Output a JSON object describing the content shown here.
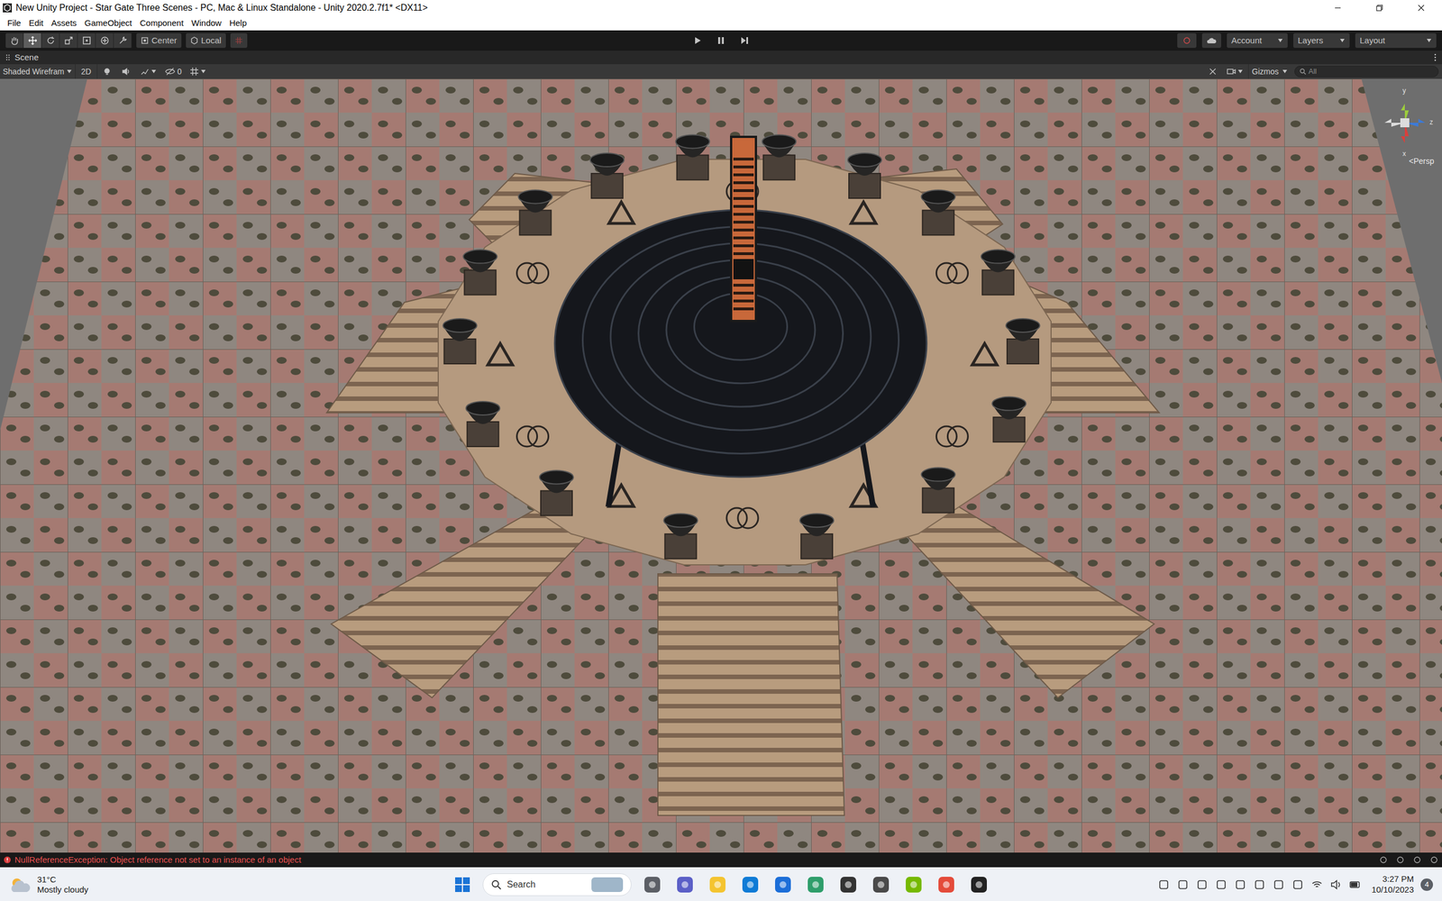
{
  "window": {
    "title": "New Unity Project - Star Gate Three Scenes - PC, Mac & Linux Standalone - Unity 2020.2.7f1* <DX11>"
  },
  "menu": [
    "File",
    "Edit",
    "Assets",
    "GameObject",
    "Component",
    "Window",
    "Help"
  ],
  "toolbar": {
    "tools": [
      {
        "kind": "hand",
        "selected": false
      },
      {
        "kind": "move",
        "selected": true
      },
      {
        "kind": "rotate",
        "selected": false
      },
      {
        "kind": "scale",
        "selected": false
      },
      {
        "kind": "rect",
        "selected": false
      },
      {
        "kind": "transform",
        "selected": false
      },
      {
        "kind": "custom",
        "selected": false
      }
    ],
    "pivot": "Center",
    "space": "Local",
    "account": "Account",
    "layers": "Layers",
    "layout": "Layout"
  },
  "scene": {
    "tab": "Scene",
    "shading": "Shaded Wirefram",
    "mode_2d": "2D",
    "mode_2d_on": false,
    "hidden_count": "0",
    "gizmos": "Gizmos",
    "search_placeholder": "All",
    "axes": {
      "y": "y",
      "z": "z",
      "x": "x"
    },
    "projection": "<Persp"
  },
  "status_bar": {
    "message": "NullReferenceException: Object reference not set to an instance of an object",
    "is_error": true
  },
  "taskbar": {
    "weather": {
      "temp": "31°C",
      "condition": "Mostly cloudy"
    },
    "search": "Search",
    "time": "3:27 PM",
    "date": "10/10/2023",
    "notifications": "4"
  }
}
